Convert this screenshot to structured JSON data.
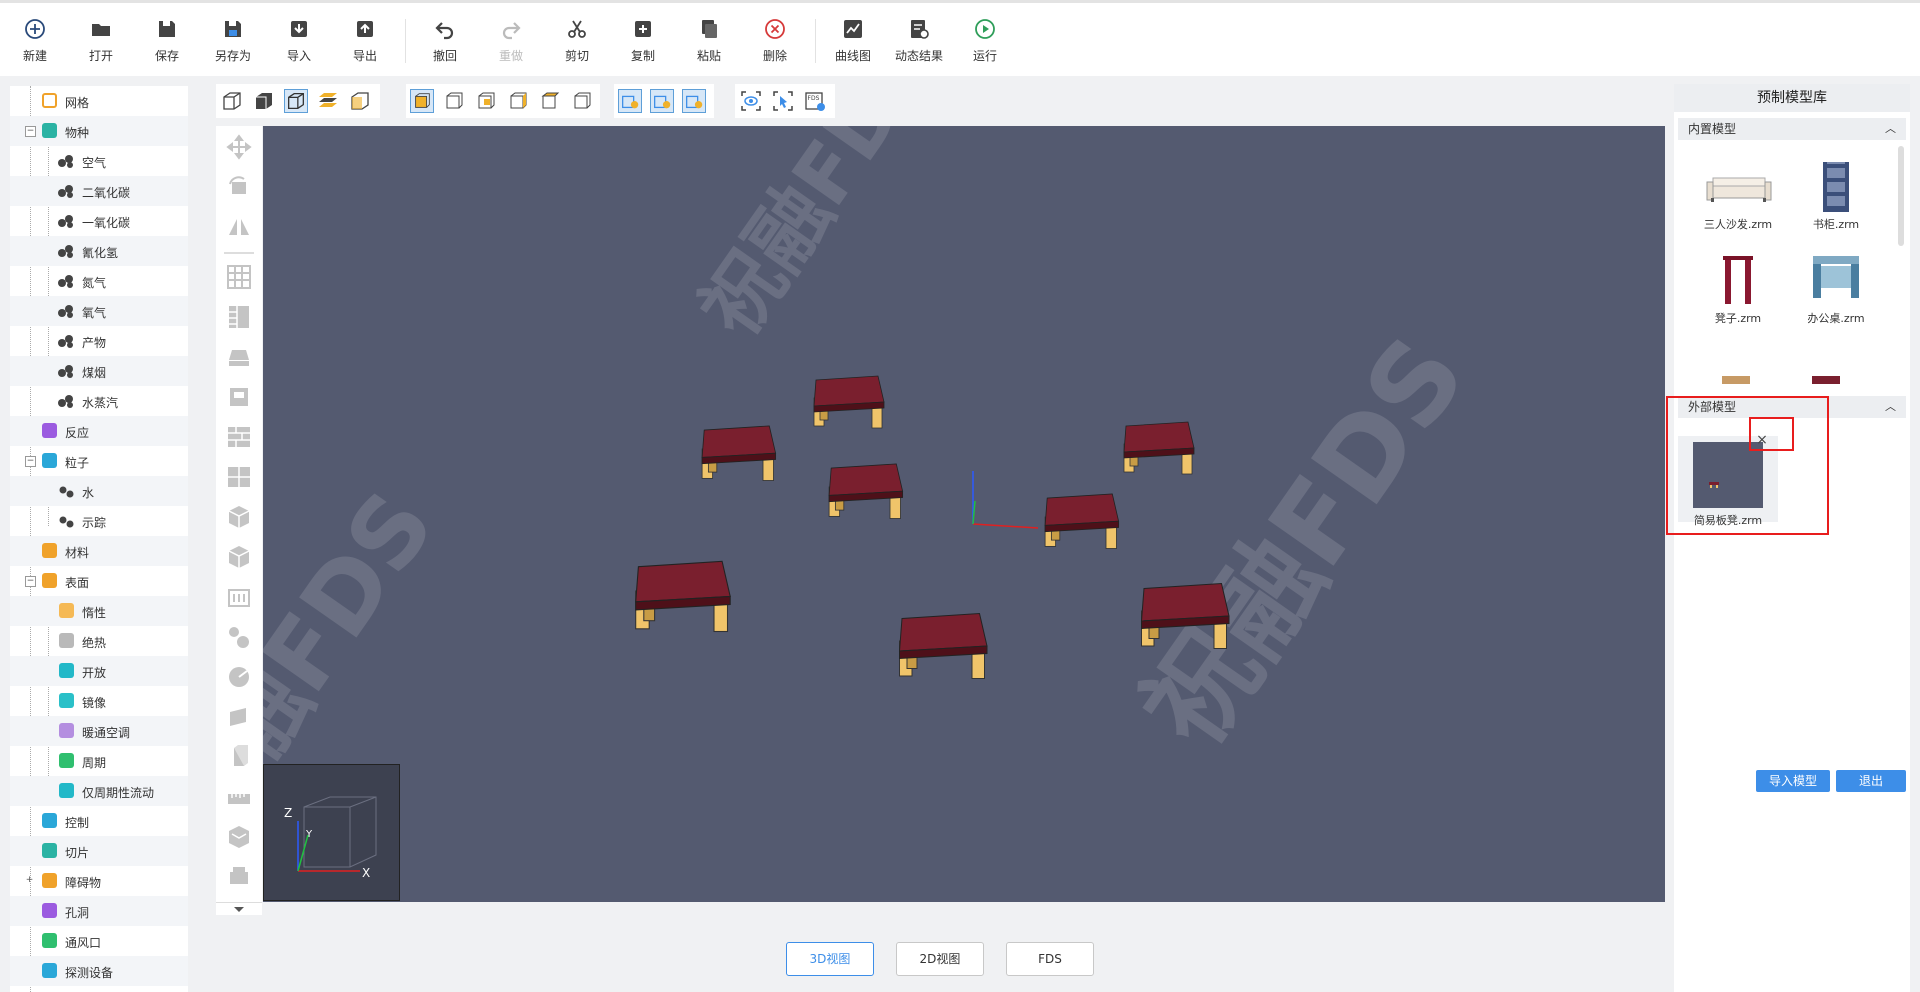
{
  "toolbar": {
    "new": "新建",
    "open": "打开",
    "save": "保存",
    "save_as": "另存为",
    "import": "导入",
    "export": "导出",
    "undo": "撤回",
    "redo": "重做",
    "cut": "剪切",
    "copy": "复制",
    "paste": "粘贴",
    "delete": "删除",
    "curve": "曲线图",
    "dynamic": "动态结果",
    "run": "运行"
  },
  "tree": {
    "items": [
      {
        "label": "网格"
      },
      {
        "label": "物种"
      },
      {
        "label": "空气"
      },
      {
        "label": "二氧化碳"
      },
      {
        "label": "一氧化碳"
      },
      {
        "label": "氰化氢"
      },
      {
        "label": "氮气"
      },
      {
        "label": "氧气"
      },
      {
        "label": "产物"
      },
      {
        "label": "煤烟"
      },
      {
        "label": "水蒸汽"
      },
      {
        "label": "反应"
      },
      {
        "label": "粒子"
      },
      {
        "label": "水"
      },
      {
        "label": "示踪"
      },
      {
        "label": "材料"
      },
      {
        "label": "表面"
      },
      {
        "label": "惰性"
      },
      {
        "label": "绝热"
      },
      {
        "label": "开放"
      },
      {
        "label": "镜像"
      },
      {
        "label": "暖通空调"
      },
      {
        "label": "周期"
      },
      {
        "label": "仅周期性流动"
      },
      {
        "label": "控制"
      },
      {
        "label": "切片"
      },
      {
        "label": "障碍物"
      },
      {
        "label": "孔洞"
      },
      {
        "label": "通风口"
      },
      {
        "label": "探测设备"
      }
    ]
  },
  "viewport": {
    "axis_z": "Z",
    "axis_x": "X",
    "axis_y": "Y",
    "watermark": "祝融FDS"
  },
  "view_tabs": {
    "view3d": "3D视图",
    "view2d": "2D视图",
    "fds": "FDS"
  },
  "library": {
    "title": "预制模型库",
    "builtin_title": "内置模型",
    "external_title": "外部模型",
    "builtin": [
      {
        "name": "三人沙发.zrm"
      },
      {
        "name": "书柜.zrm"
      },
      {
        "name": "凳子.zrm"
      },
      {
        "name": "办公桌.zrm"
      }
    ],
    "external": [
      {
        "name": "简易板凳.zrm"
      }
    ],
    "close_symbol": "×",
    "import_btn": "导入模型",
    "exit_btn": "退出"
  },
  "colors": {
    "accent": "#3d8ee8",
    "viewport_bg": "#545a70",
    "stool_top": "#7a1f2e",
    "stool_leg": "#f0c46a",
    "highlight": "#e81d1d"
  }
}
